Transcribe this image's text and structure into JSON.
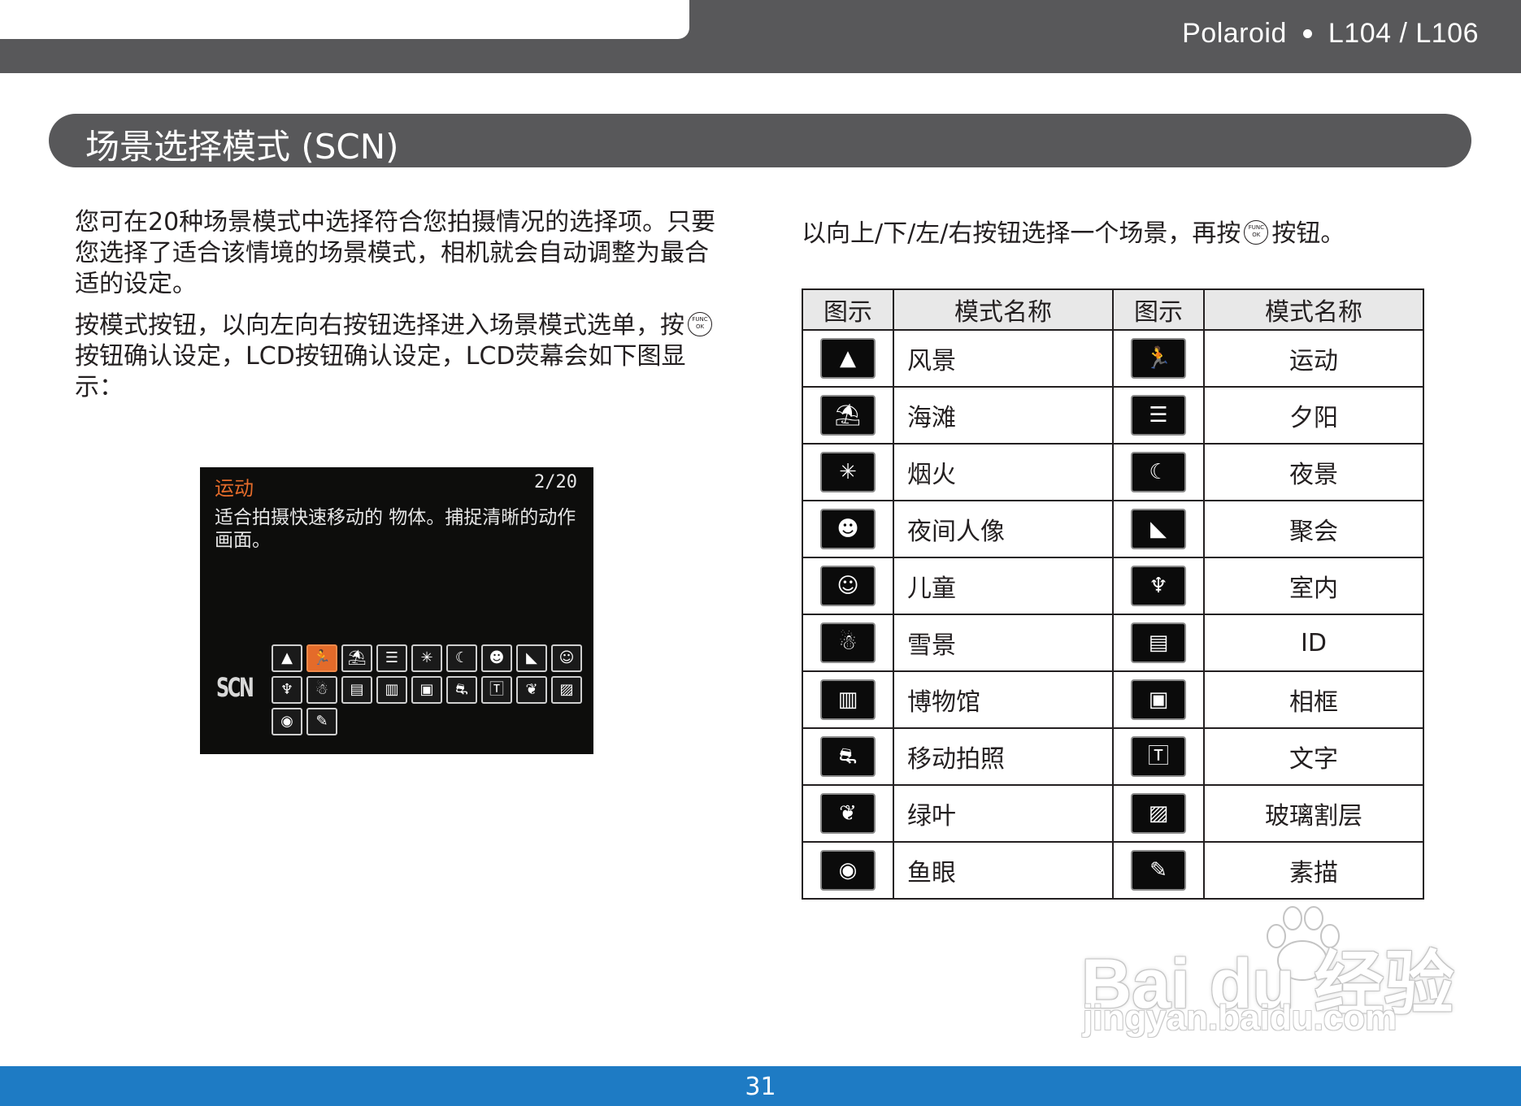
{
  "header": {
    "brand": "Polaroid",
    "model": "L104 / L106"
  },
  "section": {
    "title": "场景选择模式 (SCN)"
  },
  "left": {
    "para1": "您可在20种场景模式中选择符合您拍摄情况的选择项。只要您选择了适合该情境的场景模式，相机就会自动调整为最合适的设定。",
    "para2_a": "按模式按钮，以向左向右按钮选择进入场景模式选单，按",
    "para2_b": "按钮确认设定，LCD按钮确认设定，LCD荧幕会如下图显示："
  },
  "lcd": {
    "title": "运动",
    "page": "2/20",
    "description": "适合拍摄快速移动的 物体。捕捉清晰的动作画面。",
    "scn_label": "SCN",
    "icons": [
      {
        "name": "landscape-icon",
        "glyph": "▲"
      },
      {
        "name": "sport-icon",
        "glyph": "🏃",
        "selected": true
      },
      {
        "name": "beach-icon",
        "glyph": "⛱"
      },
      {
        "name": "sunset-icon",
        "glyph": "☰"
      },
      {
        "name": "fireworks-icon",
        "glyph": "✳"
      },
      {
        "name": "night-scene-icon",
        "glyph": "☾"
      },
      {
        "name": "night-portrait-icon",
        "glyph": "☻"
      },
      {
        "name": "party-icon",
        "glyph": "◣"
      },
      {
        "name": "kids-icon",
        "glyph": "☺"
      },
      {
        "name": "indoor-icon",
        "glyph": "♆"
      },
      {
        "name": "snow-icon",
        "glyph": "☃"
      },
      {
        "name": "id-icon",
        "glyph": "▤"
      },
      {
        "name": "museum-icon",
        "glyph": "▥"
      },
      {
        "name": "frame-icon",
        "glyph": "▣"
      },
      {
        "name": "panning-icon",
        "glyph": "⛐"
      },
      {
        "name": "text-icon",
        "glyph": "🅃"
      },
      {
        "name": "foliage-icon",
        "glyph": "❦"
      },
      {
        "name": "glass-icon",
        "glyph": "▨"
      },
      {
        "name": "fisheye-icon",
        "glyph": "◉"
      },
      {
        "name": "sketch-icon",
        "glyph": "✎"
      }
    ]
  },
  "right": {
    "instruction_a": "以向上/下/左/右按钮选择一个场景，再按",
    "instruction_b": "按钮。",
    "table": {
      "headers": [
        "图示",
        "模式名称",
        "图示",
        "模式名称"
      ],
      "rows": [
        {
          "l_icon": "landscape-icon",
          "l_glyph": "▲",
          "l_name": "风景",
          "r_icon": "sport-icon",
          "r_glyph": "🏃",
          "r_name": "运动"
        },
        {
          "l_icon": "beach-icon",
          "l_glyph": "⛱",
          "l_name": "海滩",
          "r_icon": "sunset-icon",
          "r_glyph": "☰",
          "r_name": "夕阳"
        },
        {
          "l_icon": "fireworks-icon",
          "l_glyph": "✳",
          "l_name": "烟火",
          "r_icon": "night-scene-icon",
          "r_glyph": "☾",
          "r_name": "夜景"
        },
        {
          "l_icon": "night-portrait-icon",
          "l_glyph": "☻",
          "l_name": "夜间人像",
          "r_icon": "party-icon",
          "r_glyph": "◣",
          "r_name": "聚会"
        },
        {
          "l_icon": "kids-icon",
          "l_glyph": "☺",
          "l_name": "儿童",
          "r_icon": "indoor-icon",
          "r_glyph": "♆",
          "r_name": "室内"
        },
        {
          "l_icon": "snow-icon",
          "l_glyph": "☃",
          "l_name": "雪景",
          "r_icon": "id-icon",
          "r_glyph": "▤",
          "r_name": "ID"
        },
        {
          "l_icon": "museum-icon",
          "l_glyph": "▥",
          "l_name": "博物馆",
          "r_icon": "frame-icon",
          "r_glyph": "▣",
          "r_name": "相框"
        },
        {
          "l_icon": "panning-icon",
          "l_glyph": "⛐",
          "l_name": "移动拍照",
          "r_icon": "text-icon",
          "r_glyph": "🅃",
          "r_name": "文字"
        },
        {
          "l_icon": "foliage-icon",
          "l_glyph": "❦",
          "l_name": "绿叶",
          "r_icon": "glass-icon",
          "r_glyph": "▨",
          "r_name": "玻璃割层"
        },
        {
          "l_icon": "fisheye-icon",
          "l_glyph": "◉",
          "l_name": "鱼眼",
          "r_icon": "sketch-icon",
          "r_glyph": "✎",
          "r_name": "素描"
        }
      ]
    }
  },
  "watermark": {
    "main": "Bai du 经验",
    "sub": "jingyan.baidu.com"
  },
  "footer": {
    "page_number": "31"
  },
  "colors": {
    "header_gray": "#58585a",
    "footer_blue": "#1e7bc4",
    "lcd_accent": "#e46b2a"
  }
}
